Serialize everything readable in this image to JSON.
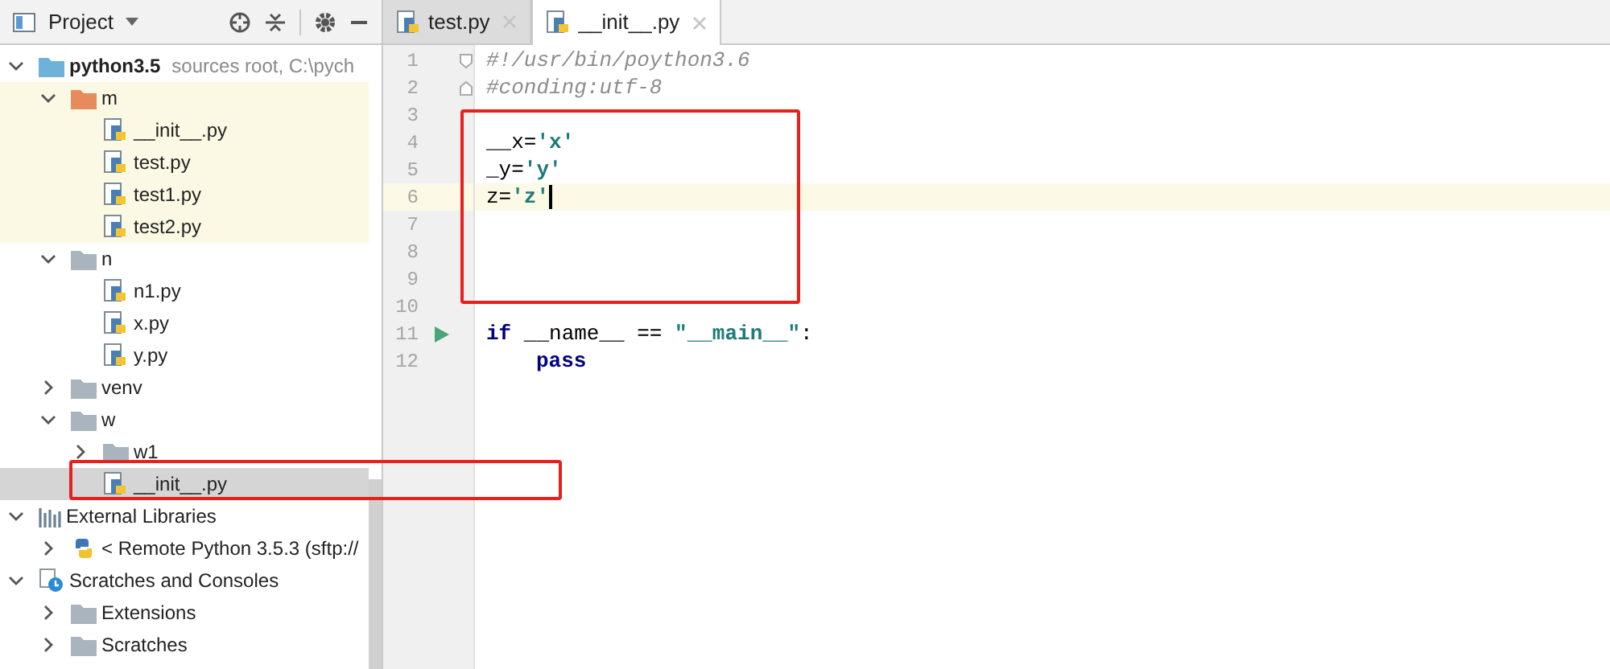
{
  "project_panel": {
    "title": "Project"
  },
  "tree": [
    {
      "label": "python3.5",
      "note": "sources root,  C:\\pych",
      "kind": "source-root",
      "expanded": true,
      "selected": false,
      "children": [
        {
          "label": "m",
          "kind": "package",
          "expanded": true,
          "selected": false,
          "highlighted": true,
          "children": [
            {
              "label": "__init__.py",
              "kind": "file",
              "selected": false
            },
            {
              "label": "test.py",
              "kind": "file",
              "selected": false
            },
            {
              "label": "test1.py",
              "kind": "file",
              "selected": false
            },
            {
              "label": "test2.py",
              "kind": "file",
              "selected": false
            }
          ]
        },
        {
          "label": "n",
          "kind": "folder",
          "expanded": true,
          "selected": false,
          "highlighted": false,
          "children": [
            {
              "label": "n1.py",
              "kind": "file",
              "selected": false
            },
            {
              "label": "x.py",
              "kind": "file",
              "selected": false
            },
            {
              "label": "y.py",
              "kind": "file",
              "selected": false
            }
          ]
        },
        {
          "label": "venv",
          "kind": "folder",
          "expanded": false,
          "selected": false,
          "highlighted": false
        },
        {
          "label": "w",
          "kind": "folder",
          "expanded": true,
          "selected": false,
          "highlighted": false,
          "children": [
            {
              "label": "w1",
              "kind": "folder",
              "expanded": false,
              "selected": false
            },
            {
              "label": "__init__.py",
              "kind": "file",
              "selected": true
            }
          ]
        }
      ]
    },
    {
      "label": "External Libraries",
      "kind": "libraries",
      "expanded": true,
      "selected": false,
      "children": [
        {
          "label": "< Remote Python 3.5.3 (sftp://",
          "kind": "sdk",
          "expanded": false,
          "selected": false
        }
      ]
    },
    {
      "label": "Scratches and Consoles",
      "kind": "scratches",
      "expanded": true,
      "selected": false,
      "children": [
        {
          "label": "Extensions",
          "kind": "folder",
          "expanded": false,
          "selected": false
        },
        {
          "label": "Scratches",
          "kind": "folder",
          "expanded": false,
          "selected": false
        }
      ]
    }
  ],
  "tabs": [
    {
      "label": "test.py",
      "selected": false
    },
    {
      "label": "__init__.py",
      "selected": true
    }
  ],
  "lines": [
    {
      "number": "1",
      "fold_start": true,
      "current": false,
      "runnable": false,
      "tokens": [
        {
          "text": "#!/usr/bin/poython3.6",
          "kind": "comment"
        }
      ]
    },
    {
      "number": "2",
      "fold_end": true,
      "current": false,
      "runnable": false,
      "tokens": [
        {
          "text": "#conding:utf-8",
          "kind": "comment"
        }
      ]
    },
    {
      "number": "3",
      "current": false,
      "runnable": false
    },
    {
      "number": "4",
      "current": false,
      "runnable": false,
      "tokens": [
        {
          "text": "__x=",
          "kind": "plain"
        },
        {
          "text": "'x'",
          "kind": "string"
        }
      ]
    },
    {
      "number": "5",
      "current": false,
      "runnable": false,
      "tokens": [
        {
          "text": "_y=",
          "kind": "plain"
        },
        {
          "text": "'y'",
          "kind": "string"
        }
      ]
    },
    {
      "number": "6",
      "current": true,
      "runnable": false,
      "tokens": [
        {
          "text": "z=",
          "kind": "plain"
        },
        {
          "text": "'z'",
          "kind": "string"
        }
      ]
    },
    {
      "number": "7",
      "current": false,
      "runnable": false
    },
    {
      "number": "8",
      "current": false,
      "runnable": false
    },
    {
      "number": "9",
      "current": false,
      "runnable": false
    },
    {
      "number": "10",
      "current": false,
      "runnable": false
    },
    {
      "number": "11",
      "current": false,
      "runnable": true,
      "tokens": [
        {
          "text": "if",
          "kind": "keyword"
        },
        {
          "text": " __name__ == ",
          "kind": "plain"
        },
        {
          "text": "\"__main__\"",
          "kind": "string"
        },
        {
          "text": ":",
          "kind": "plain"
        }
      ]
    },
    {
      "number": "12",
      "current": false,
      "runnable": false,
      "indented": true,
      "tokens": [
        {
          "text": "pass",
          "kind": "keyword"
        }
      ]
    }
  ]
}
